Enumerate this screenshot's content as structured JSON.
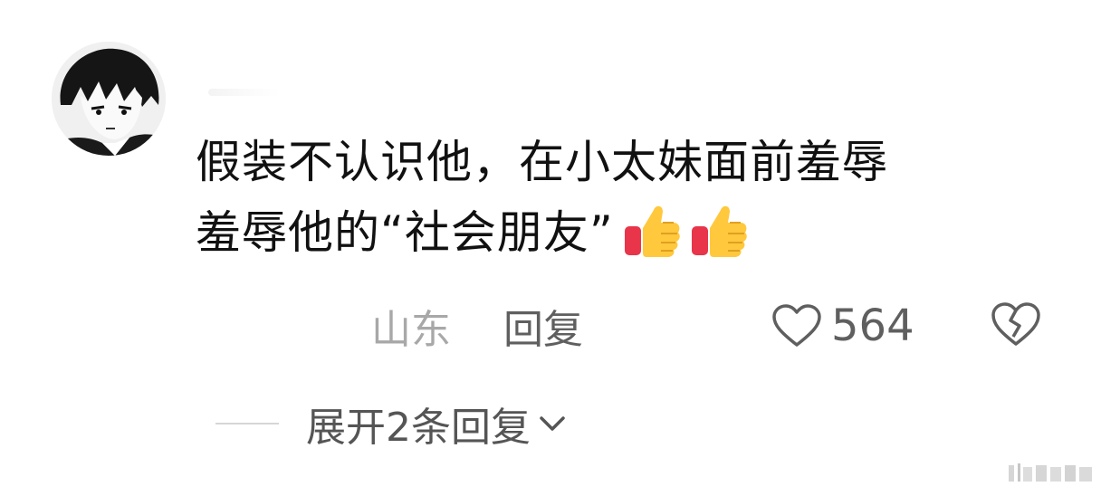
{
  "comment": {
    "line1": "假装不认识他，在小太妹面前羞辱",
    "line2": "羞辱他的“社会朋友”",
    "emojis": [
      "thumbs-up-icon",
      "thumbs-up-icon"
    ]
  },
  "meta": {
    "location": "山东",
    "reply_label": "回复",
    "like_count": "564"
  },
  "replies": {
    "expand_label": "展开2条回复"
  },
  "colors": {
    "text_primary": "#111111",
    "text_muted": "#a8a8a8",
    "text_secondary": "#5f5f5f"
  }
}
